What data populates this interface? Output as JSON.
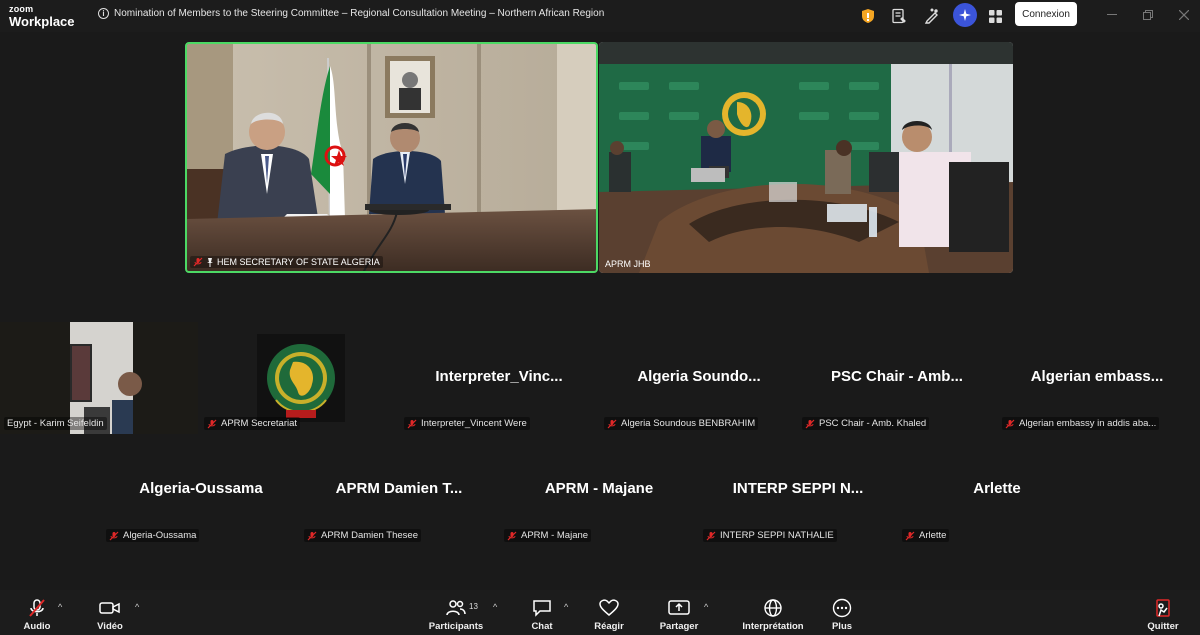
{
  "app": {
    "logo_line1": "zoom",
    "logo_line2": "Workplace"
  },
  "header": {
    "meeting_title": "Nomination of Members to the Steering Committee – Regional Consultation Meeting – Northern African Region",
    "login_label": "Connexion"
  },
  "videos": [
    {
      "label": "HEM SECRETARY OF STATE ALGERIA",
      "active_speaker": true
    },
    {
      "label": "APRM JHB"
    }
  ],
  "participants": [
    {
      "display": "",
      "label": "Egypt - Karim Seifeldin",
      "type": "video"
    },
    {
      "display": "",
      "label": "APRM Secretariat",
      "type": "logo",
      "logo_text_top": "APRM",
      "logo_text_bottom": "AUDA"
    },
    {
      "display": "Interpreter_Vinc...",
      "label": "Interpreter_Vincent Were"
    },
    {
      "display": "Algeria Soundo...",
      "label": "Algeria Soundous BENBRAHIM"
    },
    {
      "display": "PSC Chair - Amb...",
      "label": "PSC Chair - Amb. Khaled"
    },
    {
      "display": "Algerian embass...",
      "label": "Algerian embassy in addis aba..."
    },
    {
      "display": "Algeria-Oussama",
      "label": "Algeria-Oussama"
    },
    {
      "display": "APRM Damien T...",
      "label": "APRM Damien Thesee"
    },
    {
      "display": "APRM - Majane",
      "label": "APRM - Majane"
    },
    {
      "display": "INTERP SEPPI N...",
      "label": "INTERP SEPPI NATHALIE"
    },
    {
      "display": "Arlette",
      "label": "Arlette"
    }
  ],
  "toolbar": {
    "audio": "Audio",
    "video": "Vidéo",
    "participants": "Participants",
    "participants_count": "13",
    "chat": "Chat",
    "react": "Réagir",
    "share": "Partager",
    "interpretation": "Interprétation",
    "more": "Plus",
    "leave": "Quitter"
  },
  "colors": {
    "active_speaker": "#4cd964",
    "muted_red": "#e02828",
    "background": "#1a1a1a"
  }
}
